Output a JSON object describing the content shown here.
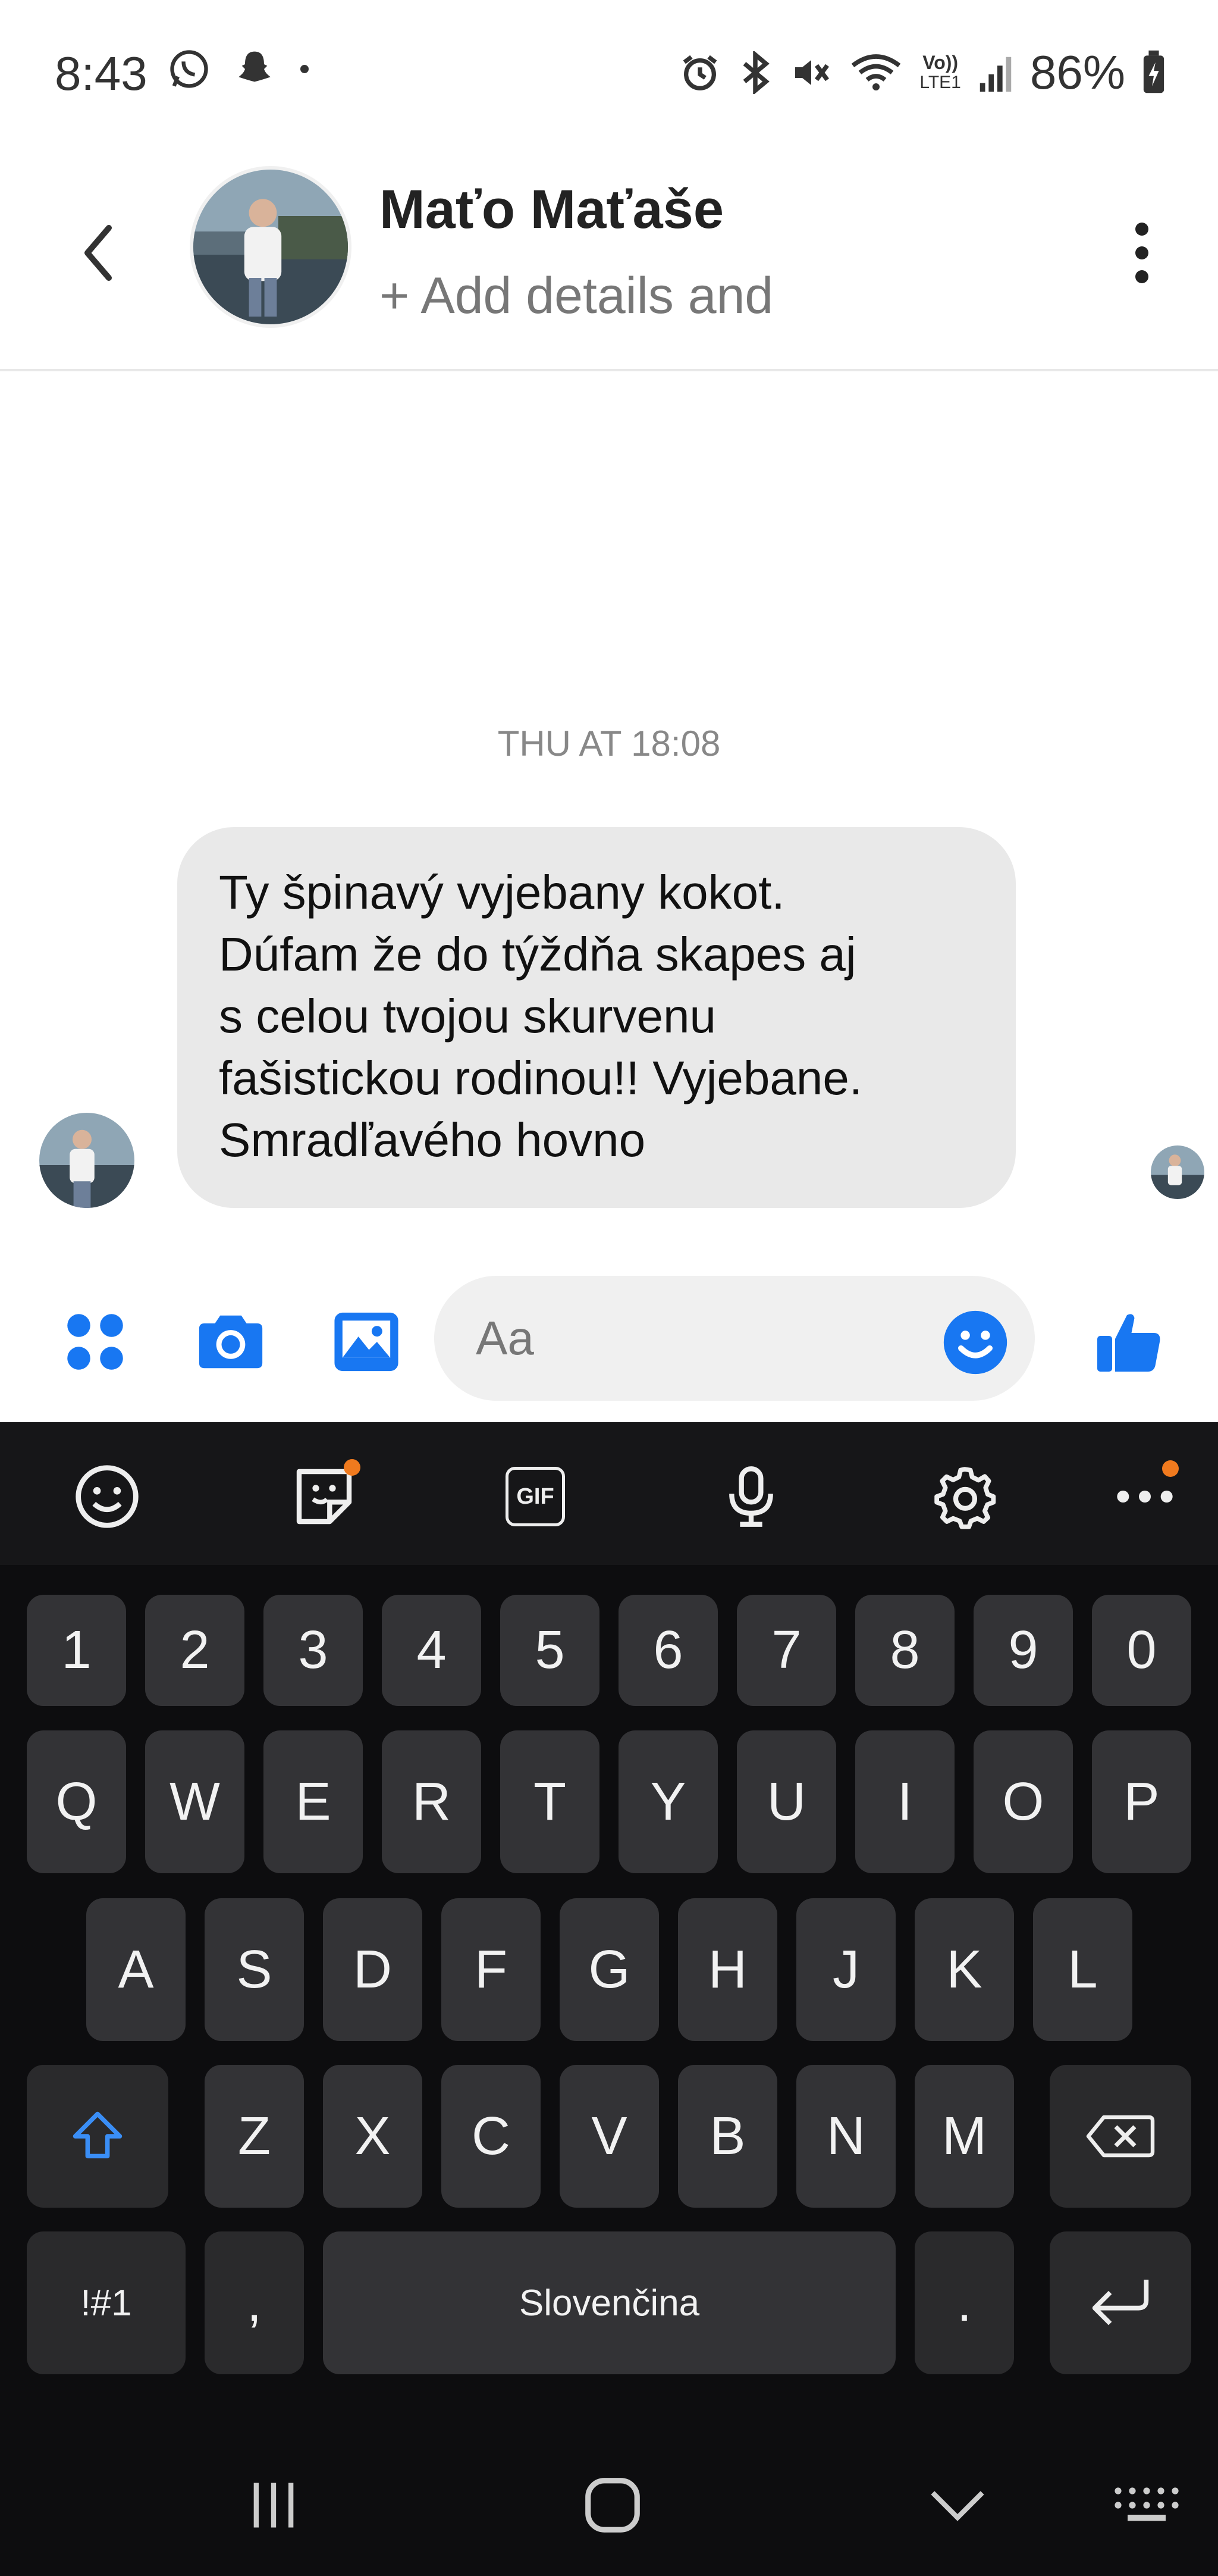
{
  "status_bar": {
    "time": "8:43",
    "battery": "86%",
    "network": "LTE1",
    "volte": "Vo))"
  },
  "header": {
    "contact_name": "Maťo Maťaše",
    "subtitle": "+ Add details and"
  },
  "conversation": {
    "timestamp": "THU AT 18:08",
    "message_lines": [
      "Ty špinavý vyjebany kokot.",
      "Dúfam že do týždňa skapes aj",
      "s celou tvojou skurvenu",
      "fašistickou rodinou!! Vyjebane.",
      "Smradľavého hovno"
    ]
  },
  "composer": {
    "placeholder": "Aa"
  },
  "keyboard": {
    "number_row": [
      "1",
      "2",
      "3",
      "4",
      "5",
      "6",
      "7",
      "8",
      "9",
      "0"
    ],
    "row1": [
      "Q",
      "W",
      "E",
      "R",
      "T",
      "Y",
      "U",
      "I",
      "O",
      "P"
    ],
    "row2": [
      "A",
      "S",
      "D",
      "F",
      "G",
      "H",
      "J",
      "K",
      "L"
    ],
    "row3": [
      "Z",
      "X",
      "C",
      "V",
      "B",
      "N",
      "M"
    ],
    "symbols_key": "!#1",
    "comma_key": ",",
    "space_label": "Slovenčina",
    "period_key": ".",
    "toolbar_gif": "GIF"
  },
  "colors": {
    "messenger_blue": "#1877f2",
    "bubble_gray": "#e9e9e9",
    "keyboard_bg": "#0d0d0f",
    "key_bg": "#333336",
    "badge_orange": "#f07a1e"
  }
}
